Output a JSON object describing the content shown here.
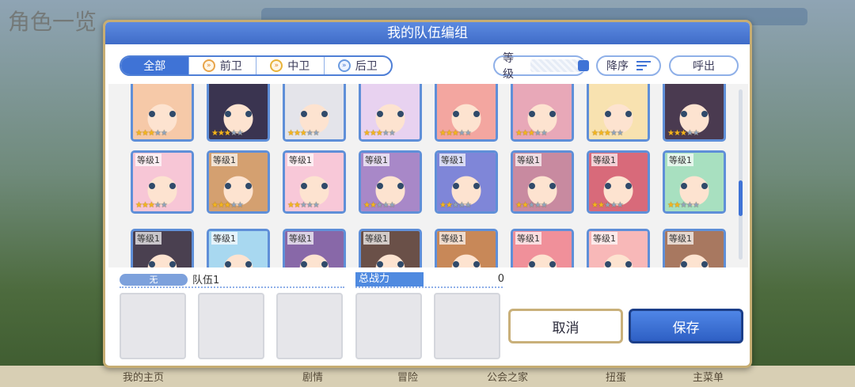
{
  "background": {
    "title": "角色一览",
    "bottom_nav": [
      "我的主页",
      "剧情",
      "冒险",
      "公会之家",
      "扭蛋",
      "主菜单"
    ]
  },
  "dialog": {
    "title": "我的队伍编组",
    "filter_tabs": [
      {
        "label": "全部",
        "active": true,
        "icon": ""
      },
      {
        "label": "前卫",
        "active": false,
        "icon": "vanguard-icon"
      },
      {
        "label": "中卫",
        "active": false,
        "icon": "midguard-icon"
      },
      {
        "label": "后卫",
        "active": false,
        "icon": "rearguard-icon"
      }
    ],
    "sort_field": "等级",
    "sort_order": "降序",
    "call_button": "呼出",
    "level_label": "等级1",
    "rows": [
      {
        "show_level": false,
        "stars": [
          3,
          3,
          3,
          3,
          3,
          3,
          3,
          3
        ]
      },
      {
        "show_level": true,
        "stars": [
          3,
          3,
          2,
          2,
          2,
          2,
          2,
          2
        ]
      },
      {
        "show_level": true,
        "stars": [
          0,
          0,
          0,
          0,
          0,
          0,
          0,
          0
        ]
      }
    ],
    "team": {
      "none_label": "无",
      "name": "队伍1",
      "power_label": "总战力",
      "power_value": "0"
    },
    "buttons": {
      "cancel": "取消",
      "save": "保存"
    }
  },
  "colors": {
    "accent": "#3f73d6",
    "gold_border": "#c6ad73",
    "card_border": "#5f8fd8"
  }
}
